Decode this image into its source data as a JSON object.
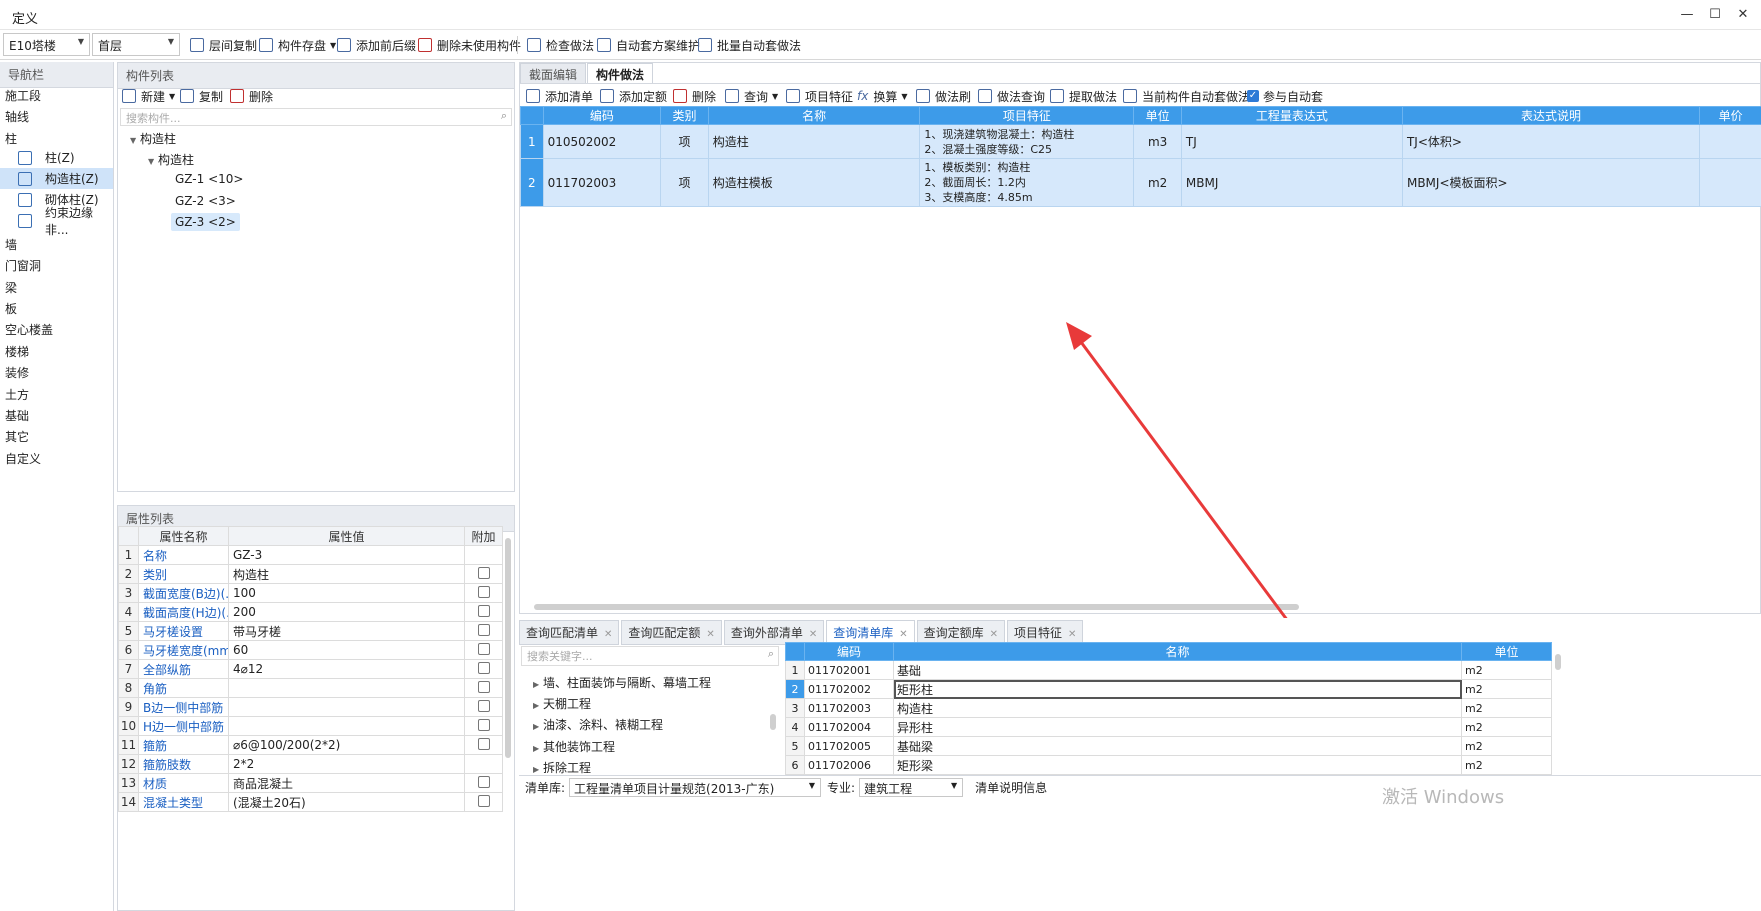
{
  "window": {
    "title": "定义"
  },
  "toolbar": {
    "building": "E10塔楼",
    "floor": "首层",
    "buttons": [
      "层间复制",
      "构件存盘",
      "添加前后缀",
      "删除未使用构件",
      "检查做法",
      "自动套方案维护",
      "批量自动套做法"
    ]
  },
  "nav": {
    "title": "导航栏",
    "items_top": [
      "施工段",
      "轴线",
      "柱"
    ],
    "sub": [
      "柱(Z)",
      "构造柱(Z)",
      "砌体柱(Z)",
      "约束边缘非..."
    ],
    "items_bottom": [
      "墙",
      "门窗洞",
      "梁",
      "板",
      "空心楼盖",
      "楼梯",
      "装修",
      "土方",
      "基础",
      "其它",
      "自定义"
    ]
  },
  "component_list": {
    "title": "构件列表",
    "actions": [
      "新建",
      "复制",
      "删除"
    ],
    "search_placeholder": "搜索构件...",
    "tree": {
      "root": "构造柱",
      "child": "构造柱",
      "leaves": [
        "GZ-1 <10>",
        "GZ-2 <3>",
        "GZ-3 <2>"
      ]
    }
  },
  "property_list": {
    "title": "属性列表",
    "headers": [
      "属性名称",
      "属性值",
      "附加"
    ],
    "rows": [
      {
        "n": "1",
        "name": "名称",
        "value": "GZ-3",
        "chk": false
      },
      {
        "n": "2",
        "name": "类别",
        "value": "构造柱",
        "chk": true
      },
      {
        "n": "3",
        "name": "截面宽度(B边)(...",
        "value": "100",
        "chk": true
      },
      {
        "n": "4",
        "name": "截面高度(H边)(...",
        "value": "200",
        "chk": true
      },
      {
        "n": "5",
        "name": "马牙槎设置",
        "value": "带马牙槎",
        "chk": true
      },
      {
        "n": "6",
        "name": "马牙槎宽度(mm)",
        "value": "60",
        "chk": true
      },
      {
        "n": "7",
        "name": "全部纵筋",
        "value": "4⌀12",
        "chk": true
      },
      {
        "n": "8",
        "name": "角筋",
        "value": "",
        "chk": true
      },
      {
        "n": "9",
        "name": "B边一侧中部筋",
        "value": "",
        "chk": true
      },
      {
        "n": "10",
        "name": "H边一侧中部筋",
        "value": "",
        "chk": true
      },
      {
        "n": "11",
        "name": "箍筋",
        "value": "⌀6@100/200(2*2)",
        "chk": true
      },
      {
        "n": "12",
        "name": "箍筋肢数",
        "value": "2*2",
        "chk": false
      },
      {
        "n": "13",
        "name": "材质",
        "value": "商品混凝土",
        "chk": true
      },
      {
        "n": "14",
        "name": "混凝土类型",
        "value": "(混凝土20石)",
        "chk": true
      }
    ]
  },
  "main": {
    "tabs": [
      "截面编辑",
      "构件做法"
    ],
    "actions": [
      "添加清单",
      "添加定额",
      "删除",
      "查询",
      "项目特征",
      "换算",
      "做法刷",
      "做法查询",
      "提取做法",
      "当前构件自动套做法",
      "参与自动套"
    ],
    "headers": [
      "编码",
      "类别",
      "名称",
      "项目特征",
      "单位",
      "工程量表达式",
      "表达式说明",
      "单价"
    ],
    "rows": [
      {
        "n": "1",
        "code": "010502002",
        "type": "项",
        "name": "构造柱",
        "feature": [
          "1、现浇建筑物混凝土：构造柱",
          "2、混凝土强度等级：C25"
        ],
        "unit": "m3",
        "expr": "TJ",
        "desc": "TJ<体积>"
      },
      {
        "n": "2",
        "code": "011702003",
        "type": "项",
        "name": "构造柱模板",
        "feature": [
          "1、模板类别：构造柱",
          "2、截面周长：1.2内",
          "3、支模高度：4.85m"
        ],
        "unit": "m2",
        "expr": "MBMJ",
        "desc": "MBMJ<模板面积>"
      }
    ]
  },
  "bottom": {
    "tabs": [
      "查询匹配清单",
      "查询匹配定额",
      "查询外部清单",
      "查询清单库",
      "查询定额库",
      "项目特征"
    ],
    "search_placeholder": "搜索关键字...",
    "categories": [
      "墙、柱面装饰与隔断、幕墙工程",
      "天棚工程",
      "油漆、涂料、裱糊工程",
      "其他装饰工程",
      "拆除工程"
    ],
    "headers": [
      "编码",
      "名称",
      "单位"
    ],
    "rows": [
      {
        "n": "1",
        "code": "011702001",
        "name": "基础",
        "unit": "m2"
      },
      {
        "n": "2",
        "code": "011702002",
        "name": "矩形柱",
        "unit": "m2"
      },
      {
        "n": "3",
        "code": "011702003",
        "name": "构造柱",
        "unit": "m2"
      },
      {
        "n": "4",
        "code": "011702004",
        "name": "异形柱",
        "unit": "m2"
      },
      {
        "n": "5",
        "code": "011702005",
        "name": "基础梁",
        "unit": "m2"
      },
      {
        "n": "6",
        "code": "011702006",
        "name": "矩形梁",
        "unit": "m2"
      }
    ],
    "footer": {
      "lib_label": "清单库:",
      "lib_value": "工程量清单项目计量规范(2013-广东)",
      "major_label": "专业:",
      "major_value": "建筑工程",
      "info": "清单说明信息"
    }
  },
  "watermark": "激活 Windows"
}
